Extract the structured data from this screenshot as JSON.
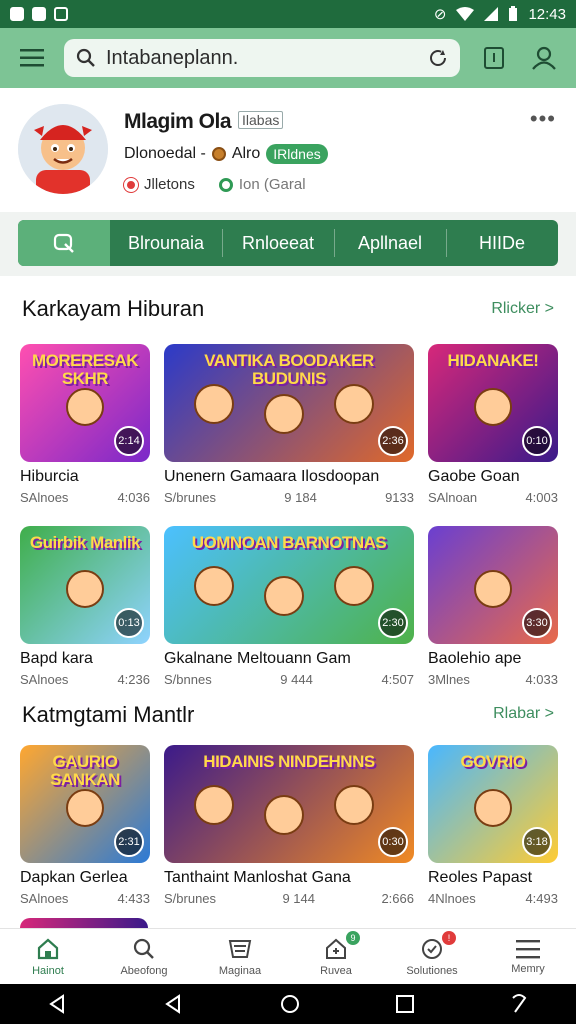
{
  "status": {
    "time": "12:43"
  },
  "search": {
    "text": "Intabaneplann."
  },
  "profile": {
    "name": "Mlagim Ola",
    "tag": "Ilabas",
    "line2_text": "Dlonoedal -",
    "line2_coin_label": "Alro",
    "badge": "IRldnes",
    "stat1": "Jlletons",
    "stat2": "Ion (Garal"
  },
  "tabs": [
    "Blrounaia",
    "Rnloeeat",
    "Apllnael",
    "HIIDe"
  ],
  "sections": [
    {
      "title": "Karkayam Hiburan",
      "link": "Rlicker >"
    },
    {
      "title": "Katmgtami Mantlr",
      "link": "Rlabar >"
    }
  ],
  "rows": [
    [
      {
        "title": "Hiburcia",
        "left": "SAlnoes",
        "right": "4:036",
        "badge": "2:14",
        "art": "MORERESAK SKHR",
        "colors": [
          "#ff4fb0",
          "#7a28c9"
        ]
      },
      {
        "title": "Unenern Gamaara Ilosdoopan",
        "left": "S/brunes",
        "right": "9133",
        "mid": "9 184",
        "badge": "2:36",
        "art": "VANTIKA BOODAKER BUDUNIS",
        "colors": [
          "#2b3ac9",
          "#e0692a"
        ]
      },
      {
        "title": "Gaobe Goan",
        "left": "SAlnoan",
        "right": "4:003",
        "badge": "0:10",
        "art": "HIDANAKE!",
        "colors": [
          "#d7287a",
          "#3a1a8a"
        ]
      }
    ],
    [
      {
        "title": "Bapd kara",
        "left": "SAlnoes",
        "right": "4:236",
        "badge": "0:13",
        "art": "Guirbik Manlik",
        "colors": [
          "#3fae4a",
          "#8fd3ff"
        ]
      },
      {
        "title": "Gkalnane Meltouann Gam",
        "left": "S/bnnes",
        "right": "4:507",
        "mid": "9 444",
        "badge": "2:30",
        "art": "UOMNOAN BARNOTNAS",
        "colors": [
          "#4cc0ff",
          "#4fb24a"
        ]
      },
      {
        "title": "Baolehio ape",
        "left": "3Mlnes",
        "right": "4:033",
        "badge": "3:30",
        "art": "",
        "colors": [
          "#6a3fd1",
          "#e86a4a"
        ]
      }
    ],
    [
      {
        "title": "Dapkan Gerlea",
        "left": "SAlnoes",
        "right": "4:433",
        "badge": "2:31",
        "art": "GAURIO SANKAN",
        "colors": [
          "#ffa730",
          "#2b7ad6"
        ]
      },
      {
        "title": "Tanthaint Manloshat Gana",
        "left": "S/brunes",
        "right": "2:666",
        "mid": "9 144",
        "badge": "0:30",
        "art": "HIDAINIS NINDEHNNS",
        "colors": [
          "#3b1a8a",
          "#f08a24"
        ]
      },
      {
        "title": "Reoles Papast",
        "left": "4Nlnoes",
        "right": "4:493",
        "badge": "3:18",
        "art": "GOVRIO",
        "colors": [
          "#49b7ff",
          "#ffcc33"
        ]
      }
    ]
  ],
  "nav": [
    {
      "label": "Hainot",
      "icon": "home-icon"
    },
    {
      "label": "Abeofong",
      "icon": "search-icon"
    },
    {
      "label": "Maginaa",
      "icon": "cart-icon"
    },
    {
      "label": "Ruvea",
      "icon": "house-badge-icon",
      "badge": "9"
    },
    {
      "label": "Solutiones",
      "icon": "notification-icon",
      "badge": "!"
    },
    {
      "label": "Memry",
      "icon": "menu-icon"
    }
  ]
}
